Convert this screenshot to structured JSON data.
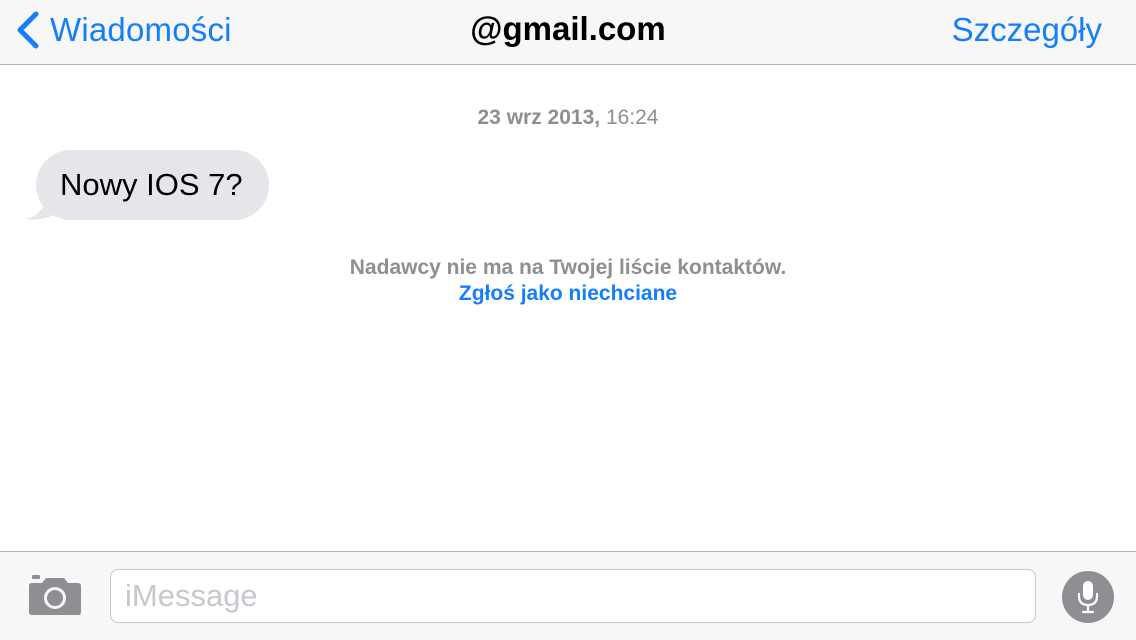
{
  "navbar": {
    "back_label": "Wiadomości",
    "title": "@gmail.com",
    "details_label": "Szczegóły"
  },
  "conversation": {
    "timestamp_date": "23 wrz 2013,",
    "timestamp_time": "16:24",
    "messages": [
      {
        "direction": "incoming",
        "text": "Nowy IOS 7?"
      }
    ],
    "notice": "Nadawcy nie ma na Twojej liście kontaktów.",
    "report_link": "Zgłoś jako niechciane"
  },
  "input_bar": {
    "placeholder": "iMessage",
    "value": "",
    "camera_icon": "camera-icon",
    "mic_icon": "microphone-icon"
  },
  "colors": {
    "accent": "#147efb",
    "bar_background": "#f7f7f8",
    "bubble_incoming": "#e5e5ea",
    "secondary_text": "#8e8e93"
  }
}
